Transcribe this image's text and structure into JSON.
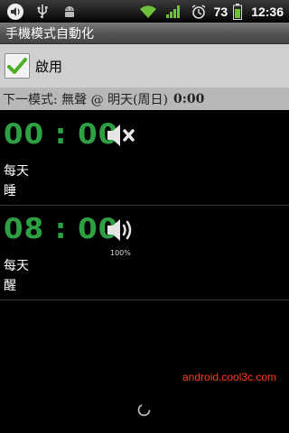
{
  "statusbar": {
    "battery_level": "73",
    "time": "12:36",
    "icons": [
      "volume-notification-icon",
      "usb-icon",
      "android-debug-icon",
      "wifi-icon",
      "signal-icon",
      "alarm-icon",
      "battery-icon"
    ]
  },
  "app": {
    "title": "手機模式自動化"
  },
  "enable": {
    "label": "啟用",
    "checked": true
  },
  "next_mode": {
    "prefix": "下一模式: 無聲 @ 明天(周日)",
    "time": "0:00"
  },
  "items": [
    {
      "time": "00 : 00",
      "days": "每天",
      "name": "睡",
      "volume_icon": "mute-icon",
      "volume_text": ""
    },
    {
      "time": "08 : 00",
      "days": "每天",
      "name": "醒",
      "volume_icon": "volume-icon",
      "volume_text": "100%"
    }
  ],
  "watermark": "android.cool3c.com",
  "colors": {
    "accent_green": "#2ea043",
    "watermark": "#ff3b1a"
  }
}
